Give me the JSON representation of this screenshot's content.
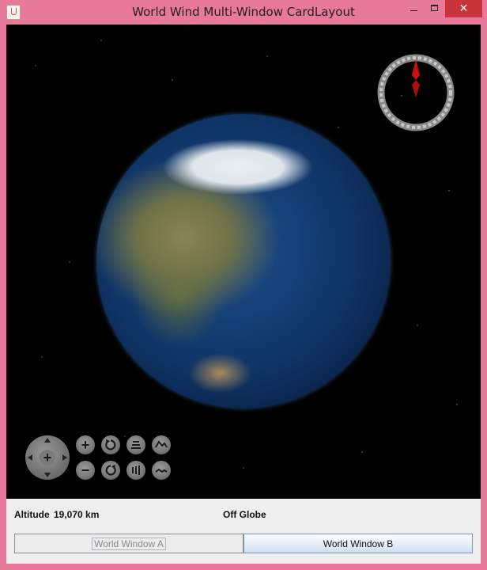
{
  "window": {
    "title": "World Wind Multi-Window CardLayout",
    "controls": {
      "minimize": "minimize-icon",
      "maximize": "maximize-icon",
      "close": "✕"
    }
  },
  "canvas": {
    "compass_icon": "compass-icon",
    "nav_buttons": {
      "pan": "pan-icon",
      "zoom_in": "+",
      "zoom_out": "−",
      "rotate_ccw": "rotate-ccw-icon",
      "rotate_cw": "rotate-cw-icon",
      "tilt_up": "tilt-up-icon",
      "tilt_down": "tilt-down-icon",
      "exaggeration_up": "exaggeration-up-icon",
      "exaggeration_down": "exaggeration-down-icon"
    }
  },
  "status": {
    "altitude_label": "Altitude",
    "altitude_value": "19,070 km",
    "position_text": "Off Globe"
  },
  "tabs": [
    {
      "label": "World Window A",
      "selected": false
    },
    {
      "label": "World Window B",
      "selected": true
    }
  ],
  "colors": {
    "title_bar": "#e8799d",
    "close_button": "#c7343a",
    "compass_needle": "#cc1010",
    "selected_tab": "#cfe1f2"
  }
}
